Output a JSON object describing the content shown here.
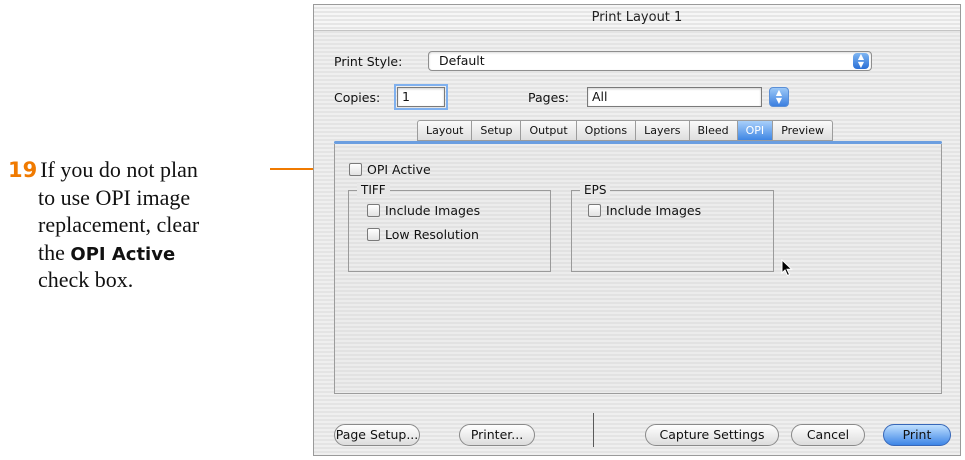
{
  "callout": {
    "step_number": "19",
    "line1": "If you do not plan",
    "line2": "to use OPI image",
    "line3": "replacement, clear",
    "line4_prefix": "the ",
    "line4_bold": "OPI Active",
    "line5": "check box.",
    "accent_color": "#f07a00"
  },
  "dialog": {
    "title": "Print Layout 1",
    "print_style_label": "Print Style:",
    "print_style_value": "Default",
    "copies_label": "Copies:",
    "copies_value": "1",
    "pages_label": "Pages:",
    "pages_value": "All",
    "tabs": [
      {
        "label": "Layout",
        "active": false
      },
      {
        "label": "Setup",
        "active": false
      },
      {
        "label": "Output",
        "active": false
      },
      {
        "label": "Options",
        "active": false
      },
      {
        "label": "Layers",
        "active": false
      },
      {
        "label": "Bleed",
        "active": false
      },
      {
        "label": "OPI",
        "active": true
      },
      {
        "label": "Preview",
        "active": false
      }
    ],
    "opi_active_label": "OPI Active",
    "opi_active_checked": false,
    "tiff": {
      "title": "TIFF",
      "include_images_label": "Include Images",
      "low_resolution_label": "Low Resolution"
    },
    "eps": {
      "title": "EPS",
      "include_images_label": "Include Images"
    },
    "buttons": {
      "page_setup": "Page Setup...",
      "printer": "Printer...",
      "capture_settings": "Capture Settings",
      "cancel": "Cancel",
      "print": "Print"
    },
    "accent_color": "#3d85e6"
  }
}
